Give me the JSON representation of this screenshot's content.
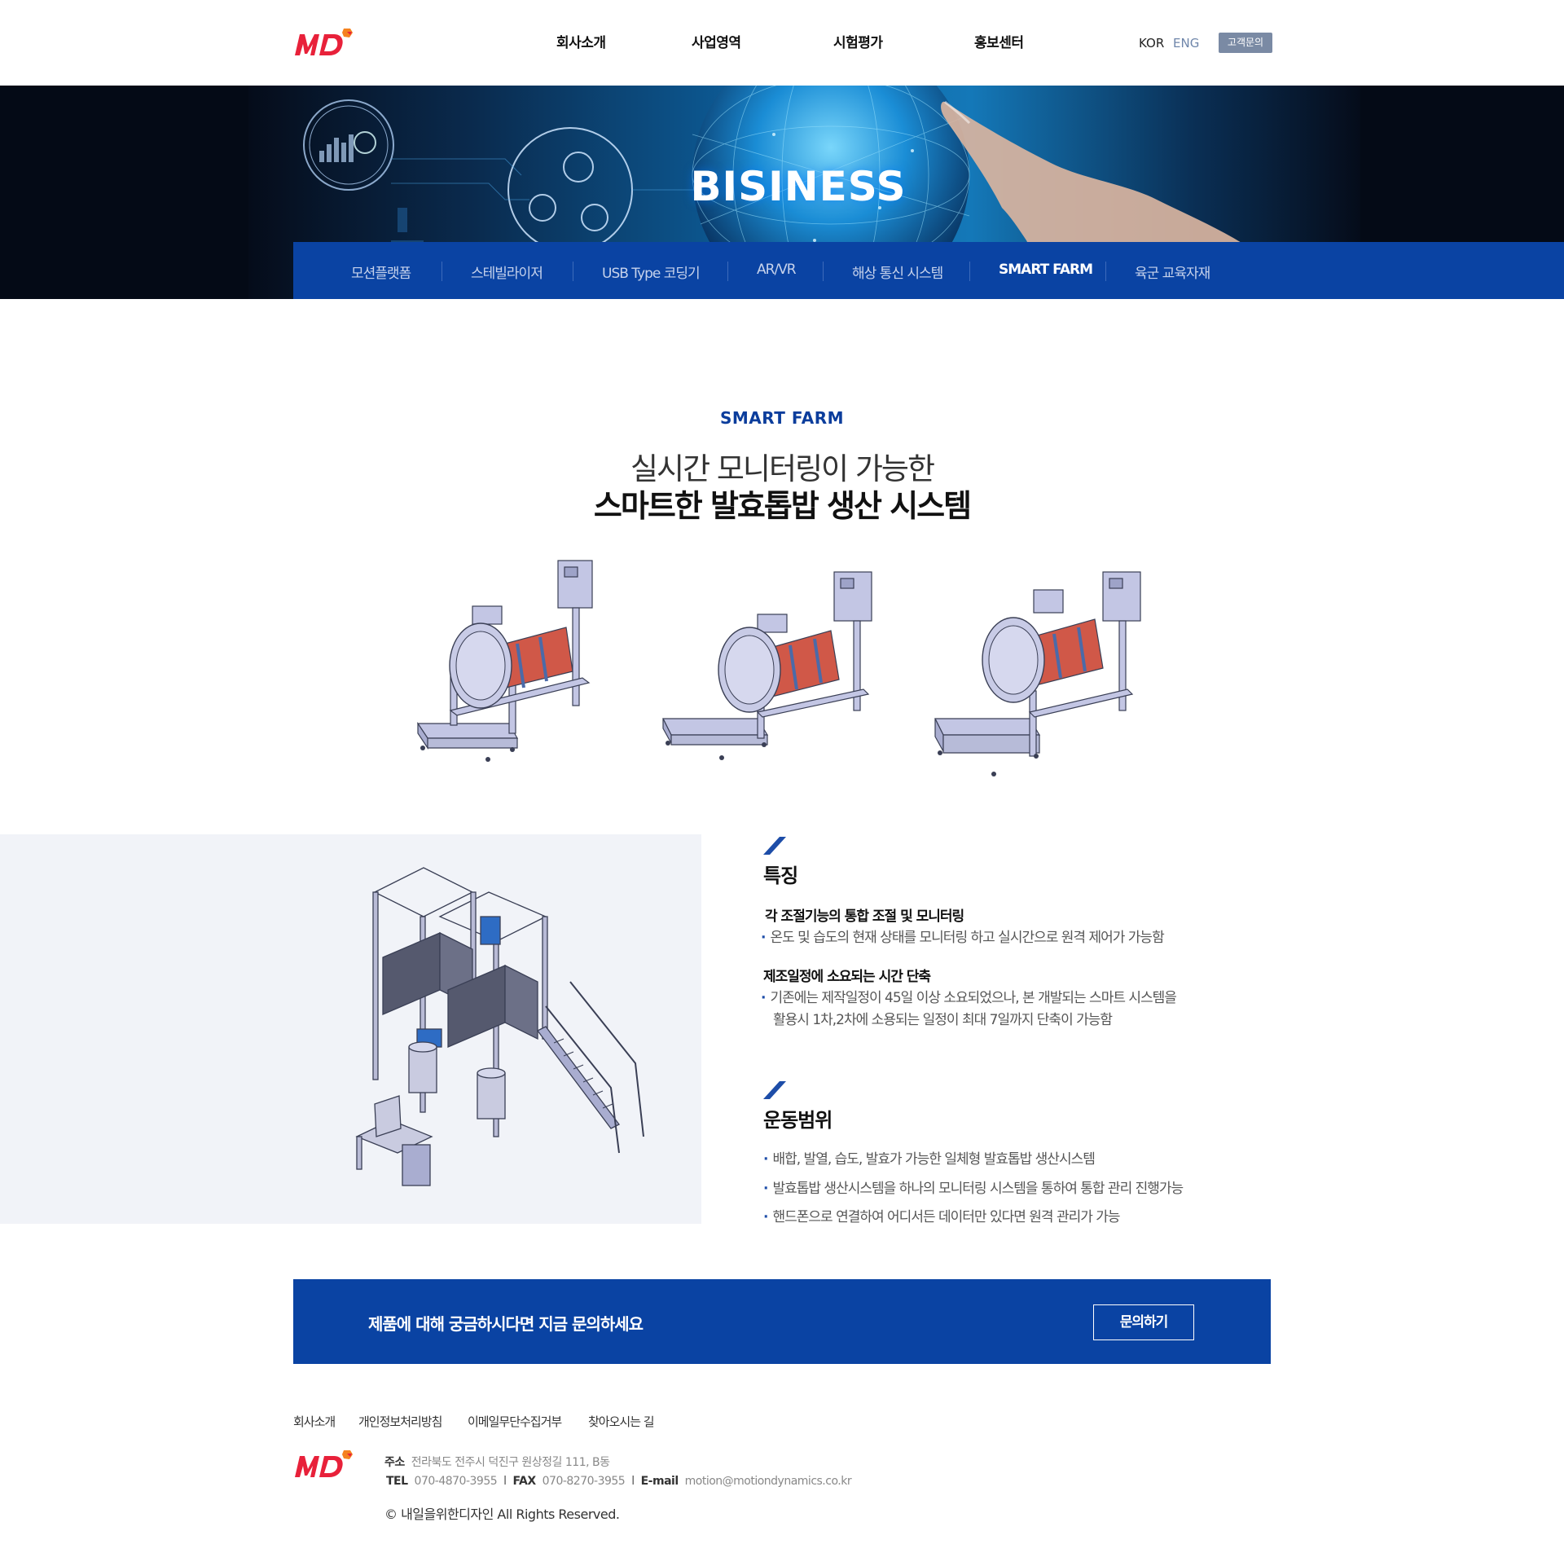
{
  "header": {
    "nav": [
      "회사소개",
      "사업영역",
      "시험평가",
      "홍보센터"
    ],
    "lang_kor": "KOR",
    "lang_eng": "ENG",
    "contact_button": "고객문의"
  },
  "hero": {
    "title": "BISINESS"
  },
  "subnav": {
    "items": [
      "모션플랫폼",
      "스테빌라이저",
      "USB Type 코딩기",
      "AR/VR",
      "해상 통신 시스템",
      "SMART FARM",
      "육군 교육자재"
    ],
    "active": "SMART FARM"
  },
  "intro": {
    "eyebrow": "SMART FARM",
    "title_line1": "실시간 모니터링이 가능한",
    "title_line2": "스마트한 발효톱밥 생산 시스템"
  },
  "features": {
    "heading": "특징",
    "groups": [
      {
        "subtitle": "각 조절기능의 통합 조절 및 모니터링",
        "lines": [
          "온도 및 습도의 현재 상태를 모니터링 하고 실시간으로 원격 제어가 가능함"
        ]
      },
      {
        "subtitle": "제조일정에 소요되는 시간 단축",
        "lines": [
          "기존에는 제작일정이 45일 이상 소요되었으나, 본 개발되는 스마트 시스템을",
          "활용시 1차,2차에 소용되는 일정이 최대 7일까지 단축이 가능함"
        ]
      }
    ]
  },
  "motion": {
    "heading": "운동범위",
    "bullets": [
      "배합, 발열, 습도, 발효가 가능한 일체형 발효톱밥 생산시스템",
      "발효톱밥 생산시스템을 하나의 모니터링 시스템을 통하여 통합 관리 진행가능",
      "핸드폰으로 연결하여 어디서든 데이터만 있다면 원격 관리가 가능"
    ]
  },
  "cta": {
    "text": "제품에 대해 궁금하시다면 지금 문의하세요",
    "button": "문의하기"
  },
  "footer": {
    "links": [
      "회사소개",
      "개인정보처리방침",
      "이메일무단수집거부",
      "찾아오시는 길"
    ],
    "address_label": "주소",
    "address": "전라북도 전주시 덕진구 원상정길 111, B동",
    "tel_label": "TEL",
    "tel": "070-4870-3955",
    "fax_label": "FAX",
    "fax": "070-8270-3955",
    "email_label": "E-mail",
    "email": "motion@motiondynamics.co.kr",
    "copyright": "© 내일을위한디자인  All Rights Reserved."
  },
  "colors": {
    "brand_blue": "#0a43a3",
    "logo_red": "#e8213a",
    "logo_orange": "#f5821f"
  }
}
